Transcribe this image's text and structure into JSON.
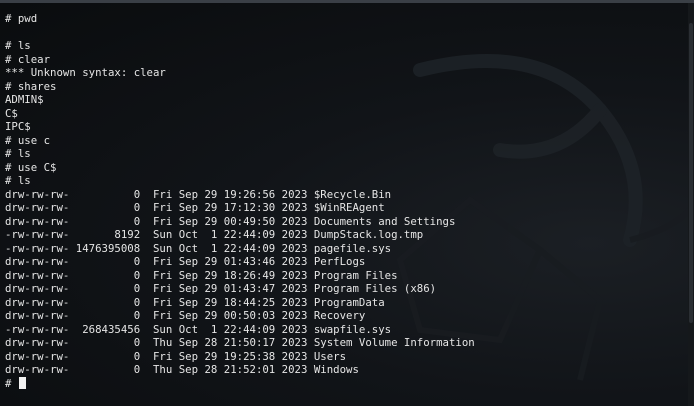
{
  "terminal": {
    "lines": [
      "# pwd",
      "",
      "# ls",
      "# clear",
      "*** Unknown syntax: clear",
      "# shares",
      "ADMIN$",
      "C$",
      "IPC$",
      "# use c",
      "# ls",
      "# use C$",
      "# ls",
      "drw-rw-rw-          0  Fri Sep 29 19:26:56 2023 $Recycle.Bin",
      "drw-rw-rw-          0  Fri Sep 29 17:12:30 2023 $WinREAgent",
      "drw-rw-rw-          0  Fri Sep 29 00:49:50 2023 Documents and Settings",
      "-rw-rw-rw-       8192  Sun Oct  1 22:44:09 2023 DumpStack.log.tmp",
      "-rw-rw-rw- 1476395008  Sun Oct  1 22:44:09 2023 pagefile.sys",
      "drw-rw-rw-          0  Fri Sep 29 01:43:46 2023 PerfLogs",
      "drw-rw-rw-          0  Fri Sep 29 18:26:49 2023 Program Files",
      "drw-rw-rw-          0  Fri Sep 29 01:43:47 2023 Program Files (x86)",
      "drw-rw-rw-          0  Fri Sep 29 18:44:25 2023 ProgramData",
      "drw-rw-rw-          0  Fri Sep 29 00:50:03 2023 Recovery",
      "-rw-rw-rw-  268435456  Sun Oct  1 22:44:09 2023 swapfile.sys",
      "drw-rw-rw-          0  Thu Sep 28 21:50:17 2023 System Volume Information",
      "drw-rw-rw-          0  Fri Sep 29 19:25:38 2023 Users",
      "drw-rw-rw-          0  Thu Sep 28 21:52:01 2023 Windows"
    ],
    "prompt": "# "
  },
  "colors": {
    "background": "#0b0d10",
    "text": "#e6e6e6",
    "cursor": "#f2f2f2"
  },
  "icons": {
    "watermark": "kali-dragon-icon"
  }
}
